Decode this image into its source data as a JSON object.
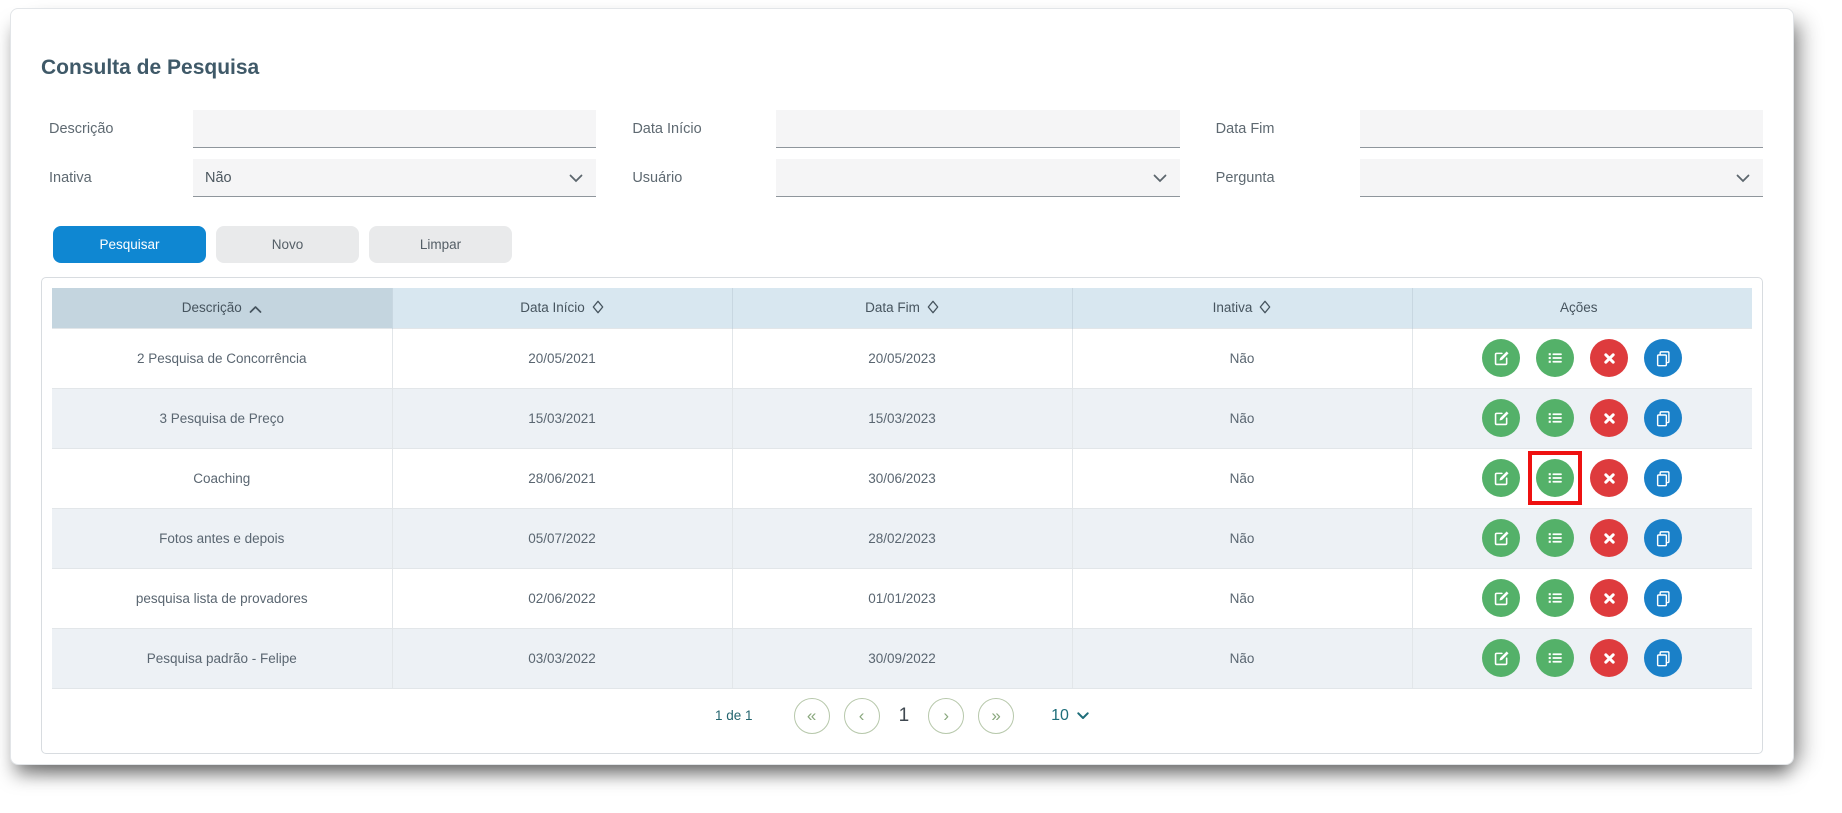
{
  "page": {
    "title": "Consulta de Pesquisa"
  },
  "filters": {
    "descricao": {
      "label": "Descrição",
      "value": ""
    },
    "data_inicio": {
      "label": "Data Início",
      "value": ""
    },
    "data_fim": {
      "label": "Data Fim",
      "value": ""
    },
    "inativa": {
      "label": "Inativa",
      "value": "Não"
    },
    "usuario": {
      "label": "Usuário",
      "value": ""
    },
    "pergunta": {
      "label": "Pergunta",
      "value": ""
    }
  },
  "toolbar": {
    "search_label": "Pesquisar",
    "new_label": "Novo",
    "clear_label": "Limpar"
  },
  "table": {
    "columns": [
      {
        "label": "Descrição",
        "sort": "asc"
      },
      {
        "label": "Data Início",
        "sort": "unsorted"
      },
      {
        "label": "Data Fim",
        "sort": "unsorted"
      },
      {
        "label": "Inativa",
        "sort": "unsorted"
      },
      {
        "label": "Ações",
        "sort": "none"
      }
    ],
    "rows": [
      {
        "descricao": "2 Pesquisa de Concorrência",
        "data_inicio": "20/05/2021",
        "data_fim": "20/05/2023",
        "inativa": "Não"
      },
      {
        "descricao": "3 Pesquisa de Preço",
        "data_inicio": "15/03/2021",
        "data_fim": "15/03/2023",
        "inativa": "Não"
      },
      {
        "descricao": "Coaching",
        "data_inicio": "28/06/2021",
        "data_fim": "30/06/2023",
        "inativa": "Não"
      },
      {
        "descricao": "Fotos antes e depois",
        "data_inicio": "05/07/2022",
        "data_fim": "28/02/2023",
        "inativa": "Não"
      },
      {
        "descricao": "pesquisa lista de provadores",
        "data_inicio": "02/06/2022",
        "data_fim": "01/01/2023",
        "inativa": "Não"
      },
      {
        "descricao": "Pesquisa padrão - Felipe",
        "data_inicio": "03/03/2022",
        "data_fim": "30/09/2022",
        "inativa": "Não"
      }
    ],
    "actions": [
      {
        "name": "edit",
        "color": "#54b169"
      },
      {
        "name": "list",
        "color": "#54b169"
      },
      {
        "name": "delete",
        "color": "#de3b3d"
      },
      {
        "name": "copy",
        "color": "#1a80c8"
      }
    ]
  },
  "annotation": {
    "row_index": 2,
    "action": "list",
    "color": "#ee1111"
  },
  "pagination": {
    "count_label": "1 de 1",
    "page": "1",
    "page_size": "10",
    "icons": {
      "first": "«",
      "prev": "‹",
      "next": "›",
      "last": "»"
    }
  },
  "colors": {
    "primary_button": "#0f87d2",
    "secondary_button": "#e9eaeb",
    "header_bg": "#d8e7f0",
    "header_sorted_bg": "#c4d5df",
    "row_alt_bg": "#edf1f5",
    "action_green": "#54b169",
    "action_red": "#de3b3d",
    "action_blue": "#1a80c8",
    "pagination_accent": "#24656f",
    "annotation_red": "#ee1111"
  }
}
